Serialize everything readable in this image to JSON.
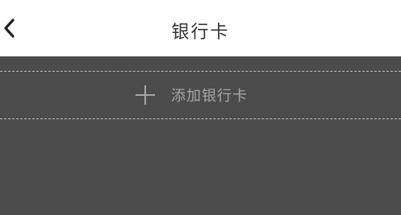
{
  "header": {
    "title": "银行卡",
    "back_icon": "chevron-left-icon"
  },
  "main": {
    "add_card": {
      "label": "添加银行卡",
      "icon": "plus-icon"
    }
  },
  "colors": {
    "header_bg": "#ffffff",
    "content_bg": "#4b4b4b",
    "dashed_border": "#bdbdbd",
    "muted_text": "#a6a6a6"
  }
}
